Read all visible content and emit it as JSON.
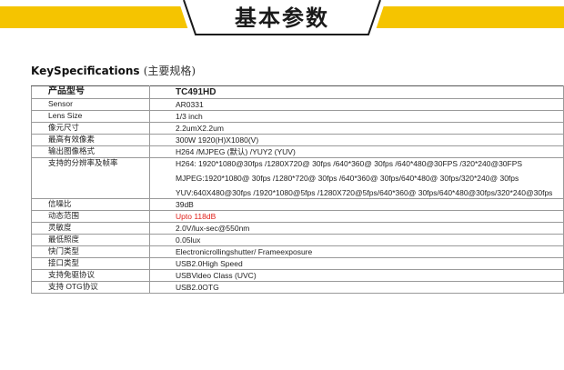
{
  "banner": {
    "title": "基本参数",
    "color": "#f5c400"
  },
  "heading": {
    "main": "KeySpecifications",
    "sub": "(主要规格)"
  },
  "rows": [
    {
      "label": "产品型号",
      "value": [
        "TC491HD"
      ],
      "head": true
    },
    {
      "label": "Sensor",
      "value": [
        "AR0331"
      ]
    },
    {
      "label": "Lens Size",
      "value": [
        "1/3 inch"
      ]
    },
    {
      "label": "像元尺寸",
      "value": [
        "2.2umX2.2um"
      ]
    },
    {
      "label": "最高有效像素",
      "value": [
        "300W    1920(H)X1080(V)"
      ]
    },
    {
      "label": "输出图像格式",
      "value": [
        "H264 /MJPEG (默认) /YUY2 (YUV)"
      ]
    },
    {
      "label": "支持的分辨率及帧率",
      "value": [
        "H264: 1920*1080@30fps /1280X720@ 30fps /640*360@ 30fps /640*480@30FPS /320*240@30FPS",
        "MJPEG:1920*1080@ 30fps /1280*720@ 30fps /640*360@ 30fps/640*480@ 30fps/320*240@ 30fps",
        "YUV:640X480@30fps /1920*1080@5fps /1280X720@5fps/640*360@ 30fps/640*480@30fps/320*240@30fps"
      ]
    },
    {
      "label": "信噪比",
      "value": [
        "39dB"
      ]
    },
    {
      "label": "动态范围",
      "value": [
        "Upto 118dB"
      ],
      "accent": "#e0201a"
    },
    {
      "label": "灵敏度",
      "value": [
        "2.0V/lux-sec@550nm"
      ]
    },
    {
      "label": "最低照度",
      "value": [
        "0.05lux"
      ]
    },
    {
      "label": "快门类型",
      "value": [
        "Electronicrollingshutter/ Frameexposure"
      ]
    },
    {
      "label": "接口类型",
      "value": [
        "USB2.0High Speed"
      ]
    },
    {
      "label": "支持免驱协议",
      "value": [
        "USBVideo Class (UVC)"
      ]
    },
    {
      "label": "支持 OTG协议",
      "value": [
        "USB2.0OTG"
      ]
    }
  ]
}
